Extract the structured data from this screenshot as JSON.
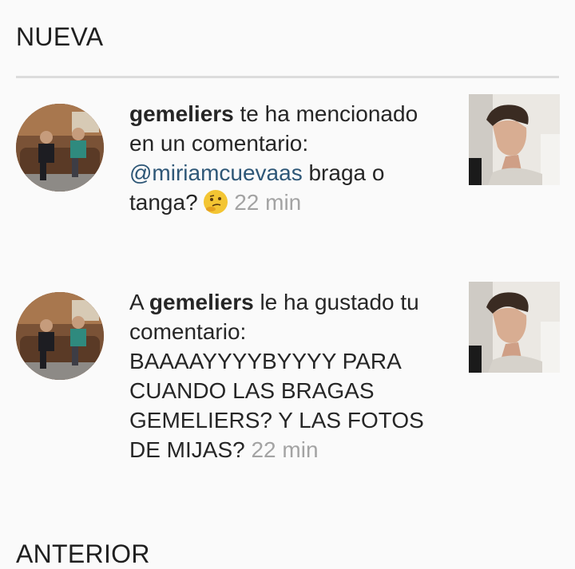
{
  "sections": {
    "new_label": "NUEVA",
    "old_label": "ANTERIOR"
  },
  "notifications": [
    {
      "avatar_icon": "user-avatar-couch-photo",
      "user": "gemeliers",
      "action": " te ha mencionado en un comentario: ",
      "mention": "@miriamcuevaas",
      "comment": " braga o tanga? ",
      "emoji": "thinking-face-emoji",
      "time": "22 min",
      "thumbnail_icon": "post-thumbnail-photo"
    },
    {
      "avatar_icon": "user-avatar-couch-photo",
      "prefix": "A ",
      "user": "gemeliers",
      "action": " le ha gustado tu comentario: ",
      "comment": "BAAAAYYYYBYYYY PARA CUANDO LAS BRAGAS GEMELIERS? Y LAS FOTOS DE MIJAS? ",
      "time": "22 min",
      "thumbnail_icon": "post-thumbnail-photo"
    }
  ],
  "colors": {
    "background": "#fafafa",
    "text": "#262626",
    "mention": "#2e5777",
    "timestamp": "#a3a3a3",
    "divider": "#dcdcdc"
  }
}
